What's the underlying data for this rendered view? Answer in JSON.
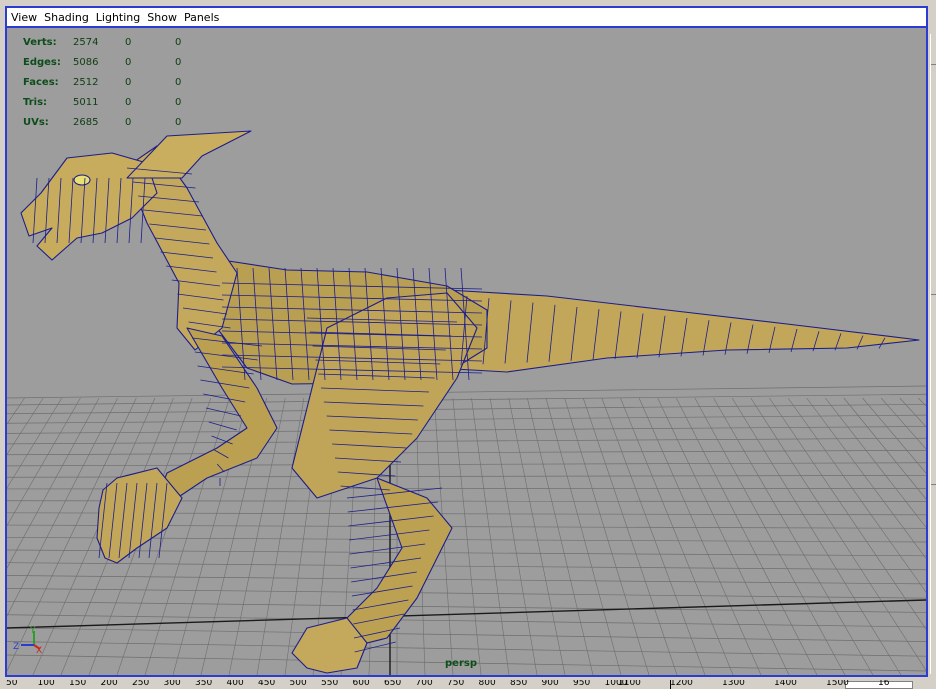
{
  "menu": {
    "items": [
      {
        "label": "View"
      },
      {
        "label": "Shading"
      },
      {
        "label": "Lighting"
      },
      {
        "label": "Show"
      },
      {
        "label": "Panels"
      }
    ]
  },
  "hud": {
    "rows": [
      {
        "label": "Verts:",
        "total": "2574",
        "selected": "0",
        "component": "0"
      },
      {
        "label": "Edges:",
        "total": "5086",
        "selected": "0",
        "component": "0"
      },
      {
        "label": "Faces:",
        "total": "2512",
        "selected": "0",
        "component": "0"
      },
      {
        "label": "Tris:",
        "total": "5011",
        "selected": "0",
        "component": "0"
      },
      {
        "label": "UVs:",
        "total": "2685",
        "selected": "0",
        "component": "0"
      }
    ]
  },
  "viewport": {
    "camera": "persp",
    "background_color": "#9d9d9d",
    "grid_color": "#6e6e6e",
    "model_color": "#c2a75a",
    "wire_color": "#1c1e8a",
    "border_color": "#2b3cd0"
  },
  "axis": {
    "y": "Y",
    "z": "Z",
    "x": "X"
  },
  "timeline": {
    "ticks": [
      "50",
      "100",
      "150",
      "200",
      "250",
      "300",
      "350",
      "400",
      "450",
      "500",
      "550",
      "600",
      "650",
      "700",
      "750",
      "800",
      "850",
      "900",
      "950",
      "1000",
      "1100",
      "1200",
      "1300",
      "1400",
      "1500",
      "16"
    ]
  }
}
